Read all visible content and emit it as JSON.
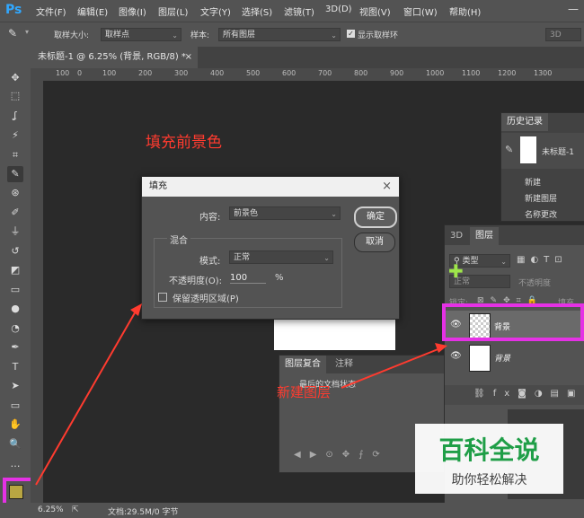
{
  "menubar": {
    "logo": "Ps",
    "items": [
      "文件(F)",
      "编辑(E)",
      "图像(I)",
      "图层(L)",
      "文字(Y)",
      "选择(S)",
      "滤镜(T)",
      "3D(D)",
      "视图(V)",
      "窗口(W)",
      "帮助(H)"
    ],
    "window_button": "—"
  },
  "options": {
    "sample_size_label": "取样大小:",
    "sample_size_value": "取样点",
    "sample_label": "样本:",
    "sample_value": "所有图层",
    "show_ring_label": "显示取样环",
    "right_field": "3D"
  },
  "document": {
    "tab_title": "未标题-1 @ 6.25% (背景, RGB/8) *",
    "ruler_ticks": [
      "100",
      "0",
      "100",
      "200",
      "300",
      "400",
      "500",
      "600",
      "700",
      "800",
      "900",
      "1000",
      "1100",
      "1200",
      "1300"
    ]
  },
  "annotations": {
    "fill_fg": "填充前景色",
    "new_layer": "新建图层"
  },
  "fill_dialog": {
    "title": "填充",
    "content_label": "内容:",
    "content_value": "前景色",
    "ok": "确定",
    "cancel": "取消",
    "blend_group": "混合",
    "mode_label": "模式:",
    "mode_value": "正常",
    "opacity_label": "不透明度(O):",
    "opacity_value": "100",
    "opacity_unit": "%",
    "preserve_label": "保留透明区域(P)"
  },
  "history": {
    "tab": "历史记录",
    "snapshot": "未标题-1",
    "items": [
      "新建",
      "新建图层",
      "名称更改"
    ]
  },
  "layers": {
    "tabs": [
      "3D",
      "图层"
    ],
    "kind": "类型",
    "blend": "正常",
    "opacity": "不透明度",
    "lock": "锁定:",
    "fill": "填充",
    "rows": [
      "背景",
      "背景"
    ]
  },
  "comps": {
    "tabs": [
      "图层复合",
      "注释"
    ],
    "last_state": "最后的文档状态"
  },
  "status": {
    "zoom": "6.25%",
    "doc": "文档:29.5M/0 字节"
  },
  "watermark": {
    "title": "百科全说",
    "sub": "助你轻松解决"
  },
  "colors": {
    "highlight": "#e531e5",
    "annotation": "#ff3b2f",
    "foreground": "#b8a642"
  }
}
